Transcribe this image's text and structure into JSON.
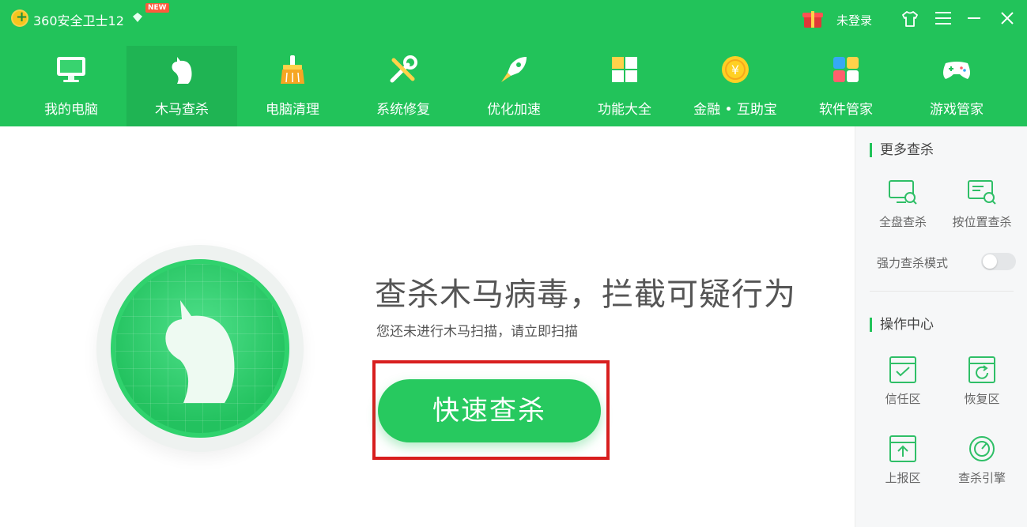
{
  "titlebar": {
    "app_name": "360安全卫士12",
    "new_badge": "NEW",
    "login_text": "未登录"
  },
  "nav": {
    "items": [
      {
        "label": "我的电脑",
        "icon": "computer-icon"
      },
      {
        "label": "木马查杀",
        "icon": "horse-icon",
        "active": true
      },
      {
        "label": "电脑清理",
        "icon": "broom-icon"
      },
      {
        "label": "系统修复",
        "icon": "tools-icon"
      },
      {
        "label": "优化加速",
        "icon": "rocket-icon"
      },
      {
        "label": "功能大全",
        "icon": "grid-icon"
      },
      {
        "label": "金融 • 互助宝",
        "icon": "coin-icon"
      },
      {
        "label": "软件管家",
        "icon": "apps-icon"
      },
      {
        "label": "游戏管家",
        "icon": "gamepad-icon"
      }
    ]
  },
  "main": {
    "headline": "查杀木马病毒，拦截可疑行为",
    "subline": "您还未进行木马扫描，请立即扫描",
    "scan_button": "快速查杀"
  },
  "sidebar": {
    "more_scan_title": "更多查杀",
    "full_scan": "全盘查杀",
    "location_scan": "按位置查杀",
    "strong_mode": "强力查杀模式",
    "strong_mode_enabled": false,
    "ops_title": "操作中心",
    "trust_zone": "信任区",
    "restore_zone": "恢复区",
    "report_zone": "上报区",
    "scan_engine": "查杀引擎"
  },
  "colors": {
    "brand_green": "#22c35a",
    "highlight_red": "#d81e1e"
  }
}
